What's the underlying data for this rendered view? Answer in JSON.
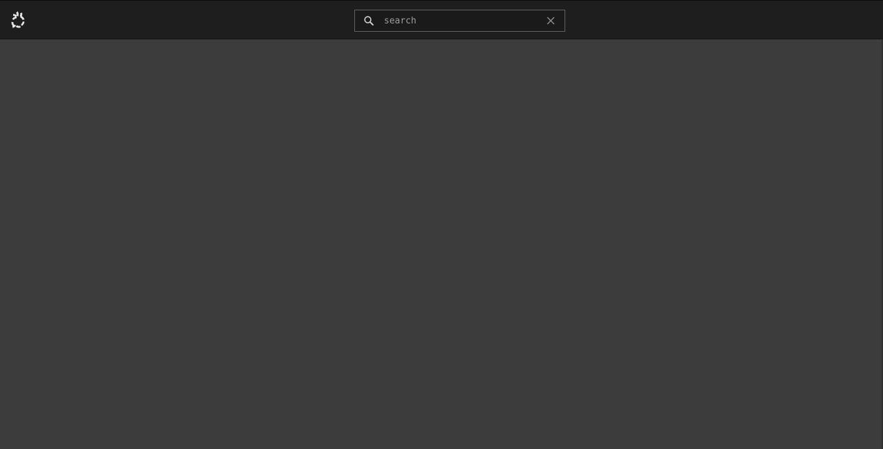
{
  "search": {
    "placeholder": "search",
    "value": ""
  },
  "icons": {
    "logo": "tri-swirl-logo-icon",
    "search": "search-icon",
    "clear": "close-icon"
  },
  "colors": {
    "topbar": "#1e1e1e",
    "content": "#3c3c3c",
    "search_border": "#616161",
    "icon": "#d0d0d0"
  }
}
